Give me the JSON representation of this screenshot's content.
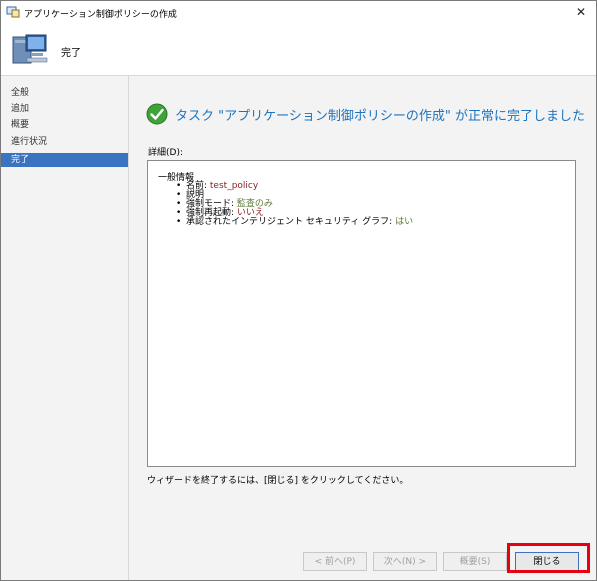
{
  "window": {
    "title": "アプリケーション制御ポリシーの作成",
    "close_glyph": "✕"
  },
  "header": {
    "title": "完了",
    "icon": "computer-icon"
  },
  "sidebar": {
    "items": [
      {
        "label": "全般",
        "active": false
      },
      {
        "label": "追加",
        "active": false
      },
      {
        "label": "概要",
        "active": false
      },
      {
        "label": "進行状況",
        "active": false
      },
      {
        "label": "完了",
        "active": true
      }
    ]
  },
  "main": {
    "status_title": "タスク \"アプリケーション制御ポリシーの作成\" が正常に完了しました",
    "status_icon": "success-check-icon",
    "details_label": "詳細(D):",
    "details": {
      "heading": "一般情報",
      "items": [
        {
          "key": "名前: ",
          "value": "test_policy"
        },
        {
          "key": "説明",
          "value": ""
        },
        {
          "key": "強制モード: ",
          "value": "監査のみ"
        },
        {
          "key": "強制再起動: ",
          "value": "いいえ"
        },
        {
          "key": "承認されたインテリジェント セキュリティ グラフ: ",
          "value": "はい"
        }
      ]
    },
    "footer_text": "ウィザードを終了するには、[閉じる] をクリックしてください。"
  },
  "buttons": {
    "back": "< 前へ(P)",
    "next": "次へ(N) >",
    "summary": "概要(S)",
    "close": "閉じる"
  },
  "colors": {
    "accent": "#1e73be",
    "selection": "#3a73c2",
    "highlight_box": "#e60012"
  }
}
